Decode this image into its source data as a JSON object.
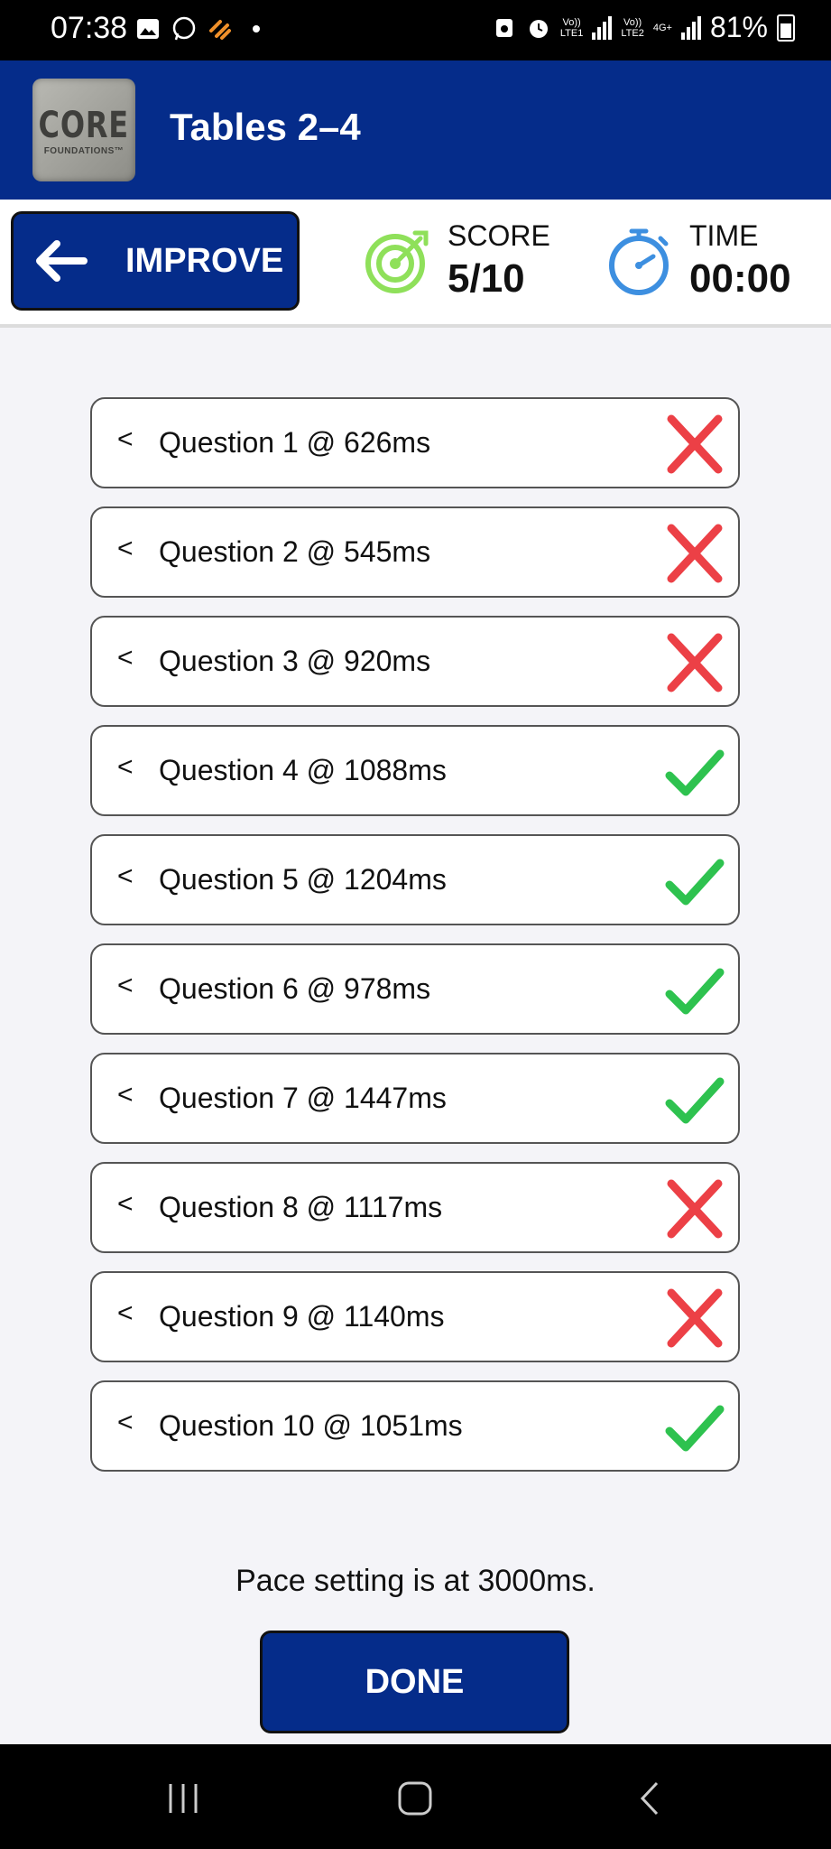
{
  "status_bar": {
    "time": "07:38",
    "battery_percent": "81%",
    "net1": [
      "Vo))",
      "LTE1"
    ],
    "net2": [
      "Vo))",
      "LTE2"
    ],
    "net_type": "4G+"
  },
  "header": {
    "logo_main": "CORE",
    "logo_sub": "FOUNDATIONS™",
    "title": "Tables 2–4",
    "color": "#052c8a"
  },
  "toolbar": {
    "improve_label": "IMPROVE",
    "score_label": "SCORE",
    "score_value": "5/10",
    "time_label": "TIME",
    "time_value": "00:00"
  },
  "questions": [
    {
      "label": "Question 1 @ 626ms",
      "correct": false
    },
    {
      "label": "Question 2 @ 545ms",
      "correct": false
    },
    {
      "label": "Question 3 @ 920ms",
      "correct": false
    },
    {
      "label": "Question 4 @ 1088ms",
      "correct": true
    },
    {
      "label": "Question 5 @ 1204ms",
      "correct": true
    },
    {
      "label": "Question 6 @ 978ms",
      "correct": true
    },
    {
      "label": "Question 7 @ 1447ms",
      "correct": true
    },
    {
      "label": "Question 8 @ 1117ms",
      "correct": false
    },
    {
      "label": "Question 9 @ 1140ms",
      "correct": false
    },
    {
      "label": "Question 10 @ 1051ms",
      "correct": true
    }
  ],
  "row_chevron": "<",
  "pace_text": "Pace setting is at 3000ms.",
  "done_label": "DONE",
  "colors": {
    "correct": "#2ec24f",
    "wrong": "#ec4046",
    "score_icon": "#8fe05a",
    "time_icon": "#3d8fe0"
  }
}
